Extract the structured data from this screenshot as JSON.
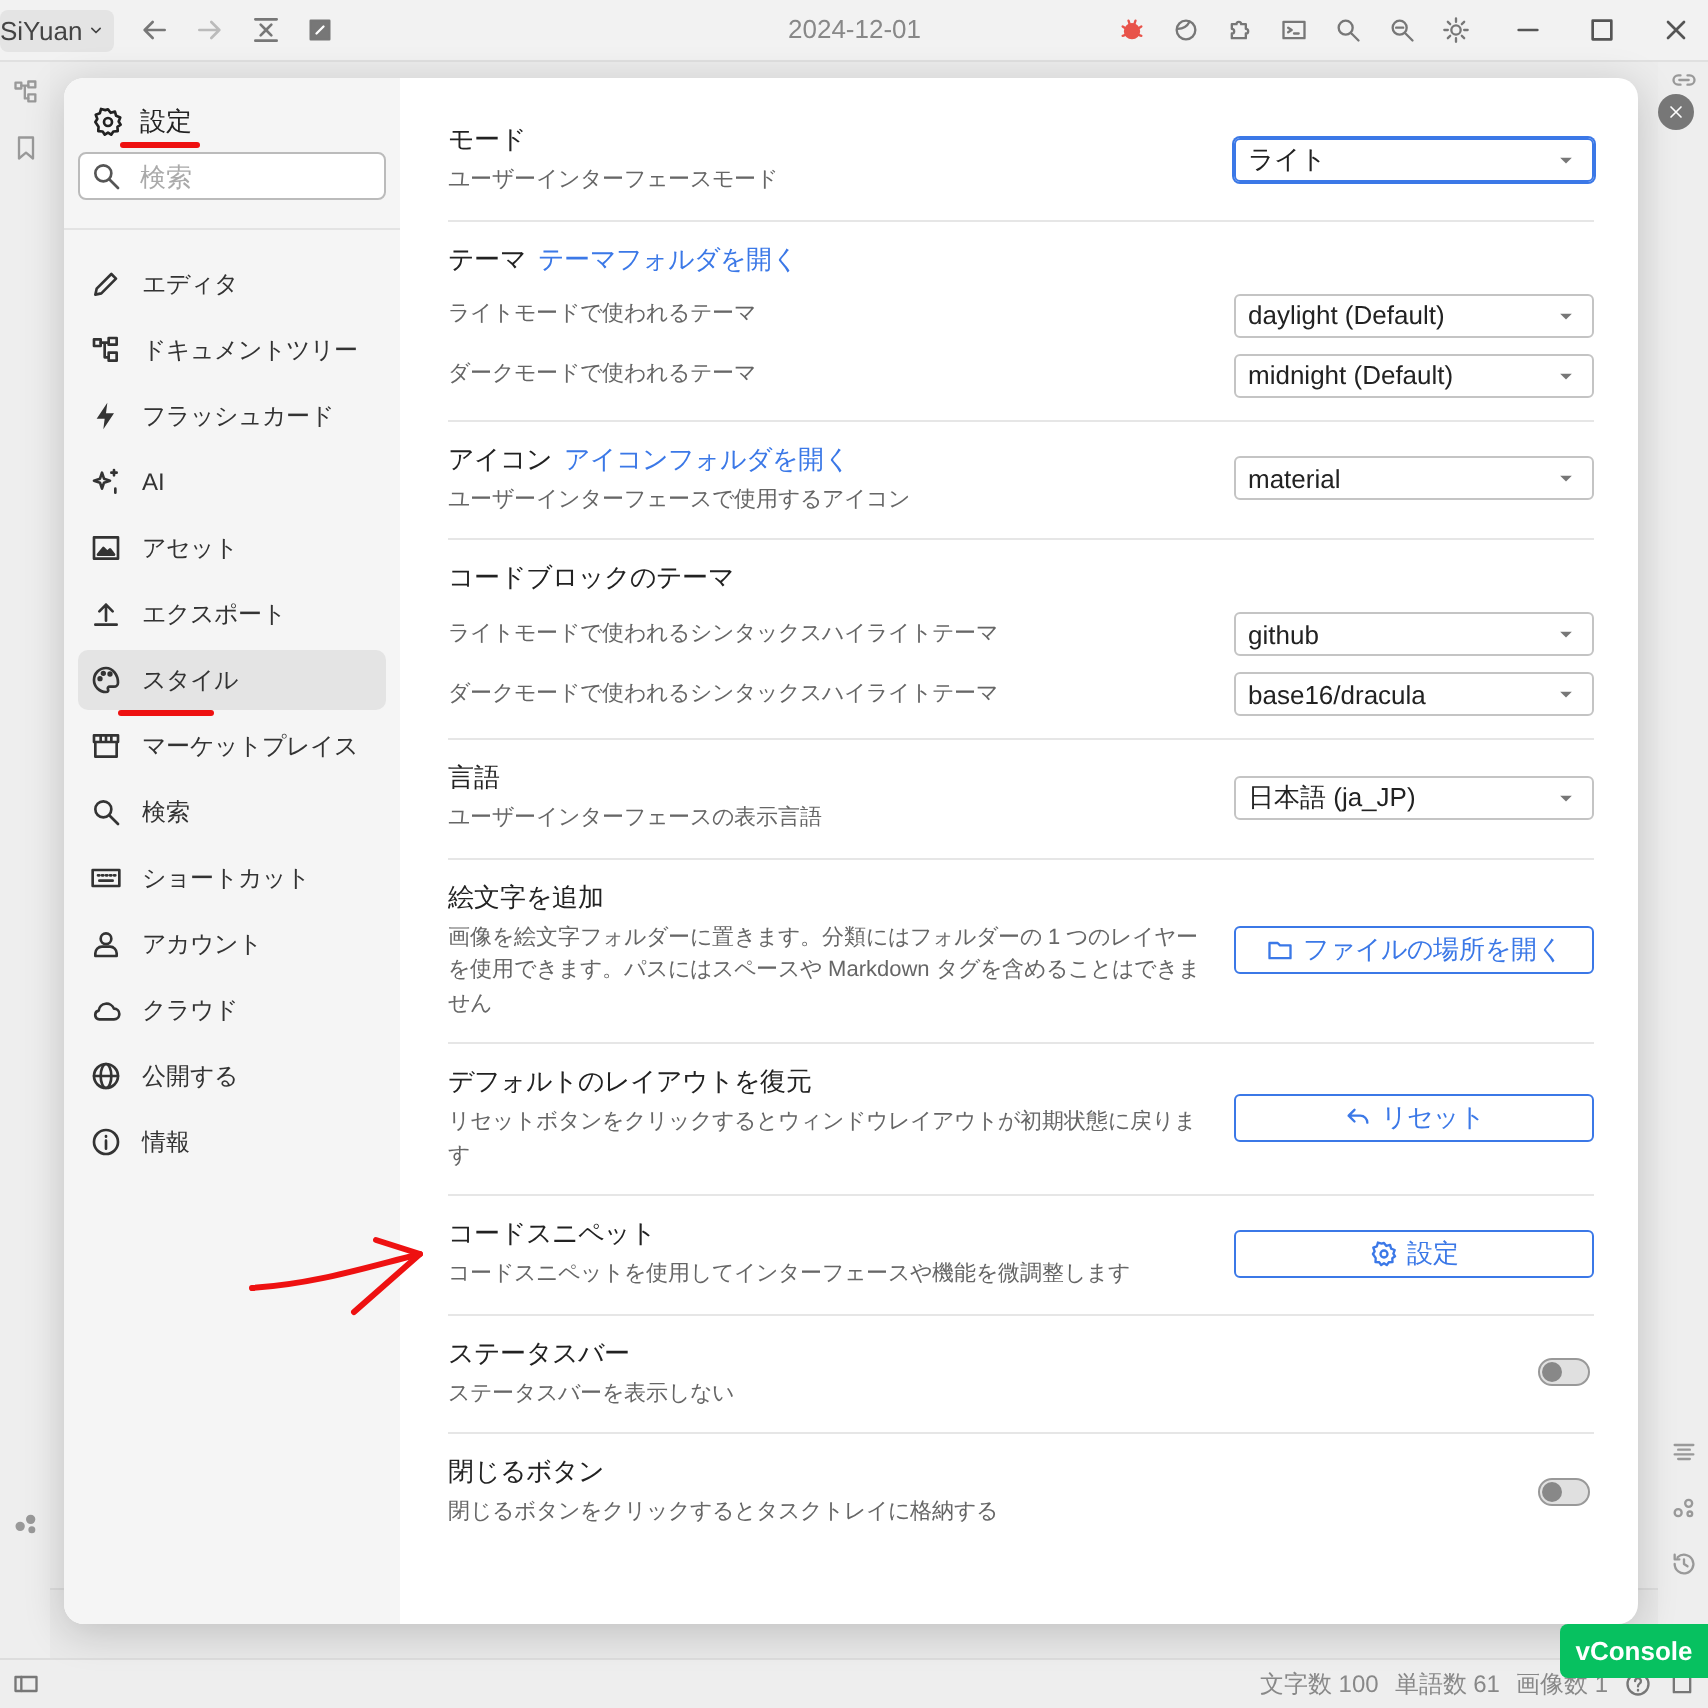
{
  "titlebar": {
    "workspace": "SiYuan",
    "date": "2024-12-01"
  },
  "settings": {
    "title": "設定",
    "search": {
      "placeholder": "検索"
    },
    "nav": [
      {
        "label": "エディタ",
        "selected": false
      },
      {
        "label": "ドキュメントツリー",
        "selected": false
      },
      {
        "label": "フラッシュカード",
        "selected": false
      },
      {
        "label": "AI",
        "selected": false
      },
      {
        "label": "アセット",
        "selected": false
      },
      {
        "label": "エクスポート",
        "selected": false
      },
      {
        "label": "スタイル",
        "selected": true
      },
      {
        "label": "マーケットプレイス",
        "selected": false
      },
      {
        "label": "検索",
        "selected": false
      },
      {
        "label": "ショートカット",
        "selected": false
      },
      {
        "label": "アカウント",
        "selected": false
      },
      {
        "label": "クラウド",
        "selected": false
      },
      {
        "label": "公開する",
        "selected": false
      },
      {
        "label": "情報",
        "selected": false
      }
    ],
    "sections": [
      {
        "title": "モード",
        "description": "ユーザーインターフェースモード",
        "control": {
          "kind": "select",
          "value": "ライト",
          "focused": true
        }
      },
      {
        "title": "テーマ",
        "link": "テーマフォルダを開く",
        "rows": [
          {
            "description": "ライトモードで使われるテーマ",
            "control": {
              "kind": "select",
              "value": "daylight (Default)",
              "focused": false
            }
          },
          {
            "description": "ダークモードで使われるテーマ",
            "control": {
              "kind": "select",
              "value": "midnight (Default)",
              "focused": false
            }
          }
        ]
      },
      {
        "title": "アイコン",
        "link": "アイコンフォルダを開く",
        "description": "ユーザーインターフェースで使用するアイコン",
        "control": {
          "kind": "select",
          "value": "material",
          "focused": false
        }
      },
      {
        "title": "コードブロックのテーマ",
        "rows": [
          {
            "description": "ライトモードで使われるシンタックスハイライトテーマ",
            "control": {
              "kind": "select",
              "value": "github",
              "focused": false
            }
          },
          {
            "description": "ダークモードで使われるシンタックスハイライトテーマ",
            "control": {
              "kind": "select",
              "value": "base16/dracula",
              "focused": false
            }
          }
        ]
      },
      {
        "title": "言語",
        "description": "ユーザーインターフェースの表示言語",
        "control": {
          "kind": "select",
          "value": "日本語 (ja_JP)",
          "focused": false
        }
      },
      {
        "title": "絵文字を追加",
        "description": "画像を絵文字フォルダーに置きます。分類にはフォルダーの 1 つのレイヤーを使用できます。パスにはスペースや Markdown タグを含めることはできません",
        "control": {
          "kind": "button",
          "label": "ファイルの場所を開く"
        }
      },
      {
        "title": "デフォルトのレイアウトを復元",
        "description": "リセットボタンをクリックするとウィンドウレイアウトが初期状態に戻ります",
        "control": {
          "kind": "button",
          "label": "リセット"
        }
      },
      {
        "title": "コードスニペット",
        "description": "コードスニペットを使用してインターフェースや機能を微調整します",
        "control": {
          "kind": "button",
          "label": "設定"
        }
      },
      {
        "title": "ステータスバー",
        "description": "ステータスバーを表示しない",
        "control": {
          "kind": "switch",
          "on": false
        }
      },
      {
        "title": "閉じるボタン",
        "description": "閉じるボタンをクリックするとタスクトレイに格納する",
        "control": {
          "kind": "switch",
          "on": false
        }
      }
    ]
  },
  "status_bar": {
    "items": [
      "文字数 100",
      "単語数 61",
      "画像数 1"
    ]
  },
  "vconsole": "vConsole"
}
